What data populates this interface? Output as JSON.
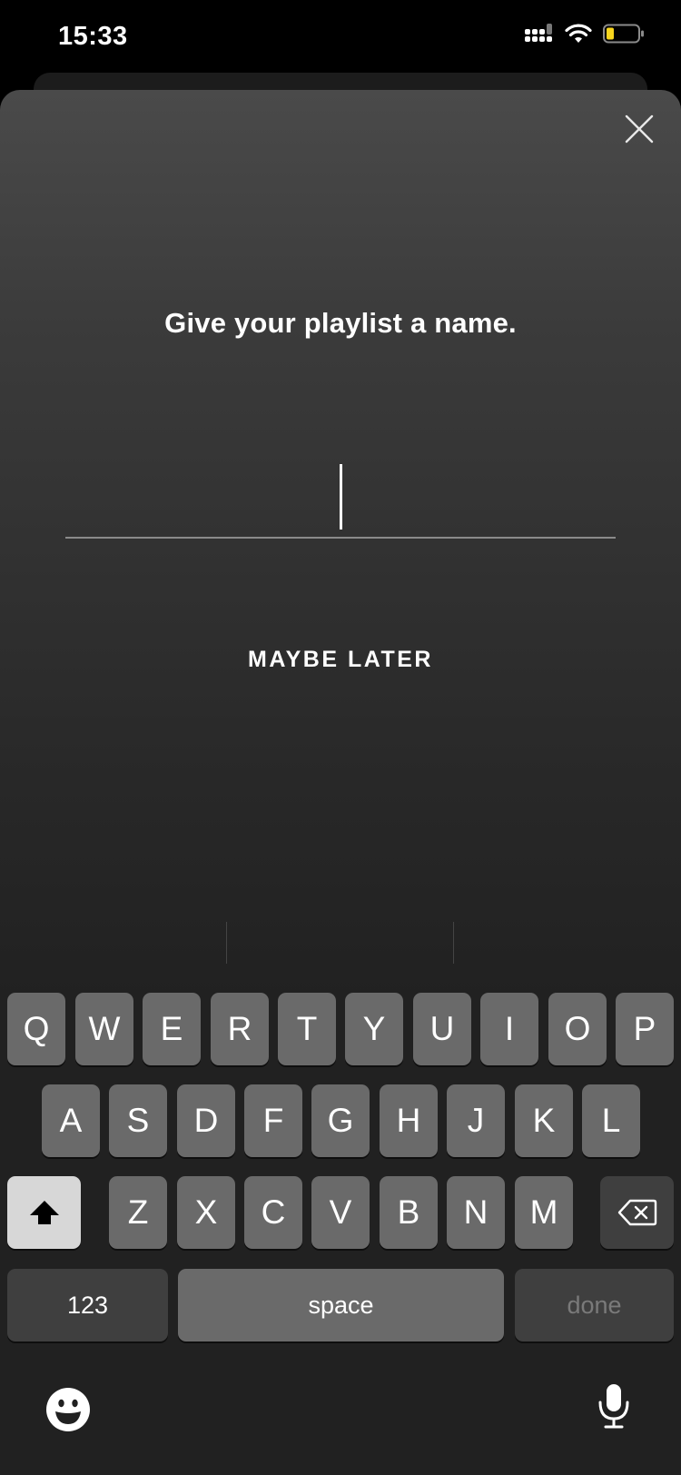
{
  "status_bar": {
    "time": "15:33",
    "battery_color": "#f7d51d"
  },
  "dialog": {
    "title": "Give your playlist a name.",
    "input_value": "",
    "secondary_action": "MAYBE LATER",
    "close_icon": "close-icon"
  },
  "keyboard": {
    "row1": [
      "Q",
      "W",
      "E",
      "R",
      "T",
      "Y",
      "U",
      "I",
      "O",
      "P"
    ],
    "row2": [
      "A",
      "S",
      "D",
      "F",
      "G",
      "H",
      "J",
      "K",
      "L"
    ],
    "row3": [
      "Z",
      "X",
      "C",
      "V",
      "B",
      "N",
      "M"
    ],
    "numbers_key": "123",
    "space_key": "space",
    "done_key": "done",
    "shift_icon": "shift-arrow-icon",
    "delete_icon": "backspace-icon",
    "emoji_icon": "emoji-icon",
    "mic_icon": "microphone-icon"
  }
}
